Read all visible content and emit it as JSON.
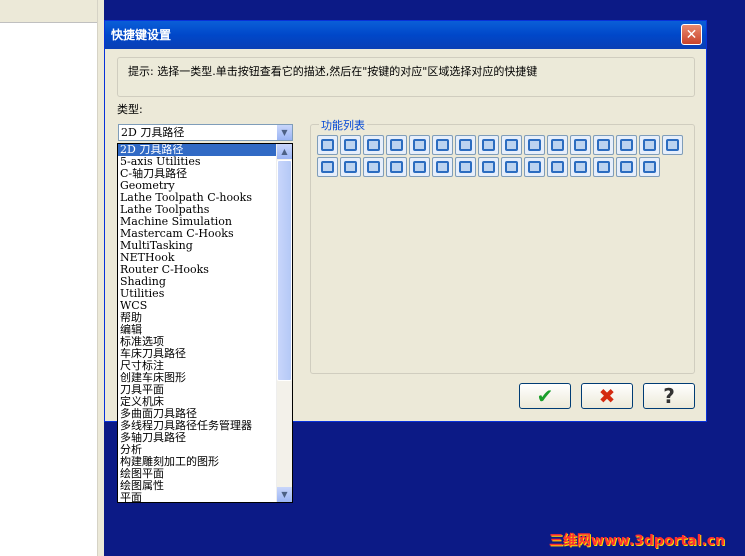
{
  "dialog": {
    "title": "快捷键设置",
    "hint": "提示: 选择一类型.单击按钮查看它的描述,然后在\"按键的对应\"区域选择对应的快捷键",
    "type_label": "类型:",
    "type_selected": "2D 刀具路径",
    "function_list_label": "功能列表",
    "icon_count": 31,
    "buttons": {
      "ok": "✔",
      "cancel": "✖",
      "help": "?"
    }
  },
  "dropdown": {
    "items": [
      "2D 刀具路径",
      "5-axis Utilities",
      "C-轴刀具路径",
      "Geometry",
      "Lathe Toolpath C-hooks",
      "Lathe Toolpaths",
      "Machine Simulation",
      "Mastercam C-Hooks",
      "MultiTasking",
      "NETHook",
      "Router C-Hooks",
      "Shading",
      "Utilities",
      "WCS",
      "帮助",
      "编辑",
      "标准选项",
      "车床刀具路径",
      "尺寸标注",
      "创建车床图形",
      "刀具平面",
      "定义机床",
      "多曲面刀具路径",
      "多线程刀具路径任务管理器",
      "多轴刀具路径",
      "分析",
      "构建雕刻加工的图形",
      "绘图平面",
      "绘图属性",
      "平面"
    ],
    "selected_index": 0
  },
  "watermark": "三维网www.3dportal.cn",
  "colors": {
    "desktop": "#0c1a86",
    "dialog": "#ece9d8",
    "selection": "#316ac5",
    "titlebar": "#0047c9"
  }
}
